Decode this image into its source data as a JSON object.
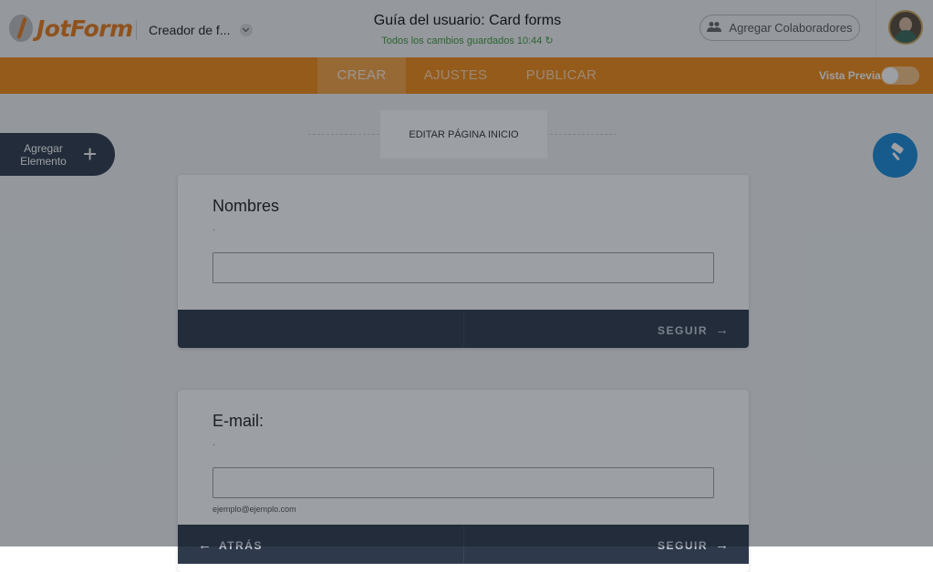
{
  "header": {
    "logo_text": "JotForm",
    "creator_label": "Creador de f...",
    "doc_title": "Guía del usuario: Card forms",
    "save_status": "Todos los cambios guardados 10:44",
    "collab_label": "Agregar Colaboradores"
  },
  "nav": {
    "tabs": [
      {
        "label": "CREAR",
        "active": true
      },
      {
        "label": "AJUSTES",
        "active": false
      },
      {
        "label": "PUBLICAR",
        "active": false
      }
    ],
    "preview_label": "Vista Previa",
    "preview_on": false
  },
  "canvas": {
    "start_button": "EDITAR PÁGINA INICIO",
    "add_element": {
      "line1": "Agregar",
      "line2": "Elemento"
    },
    "cards": [
      {
        "question": "Nombres",
        "dot": ".",
        "sublabel": "",
        "next_label": "SEGUIR",
        "back_label": ""
      },
      {
        "question": "E-mail:",
        "dot": ".",
        "sublabel": "ejemplo@ejemplo.com",
        "next_label": "SEGUIR",
        "back_label": "ATRÁS"
      }
    ]
  },
  "colors": {
    "brand_orange": "#f38a13",
    "card_footer": "#2e3a4b",
    "paint_button": "#1a88d8",
    "save_green": "#3c9a3c"
  },
  "icons": {
    "collab": "people-icon",
    "refresh": "refresh-icon",
    "paint": "paint-roller-icon",
    "add": "plus-icon"
  }
}
